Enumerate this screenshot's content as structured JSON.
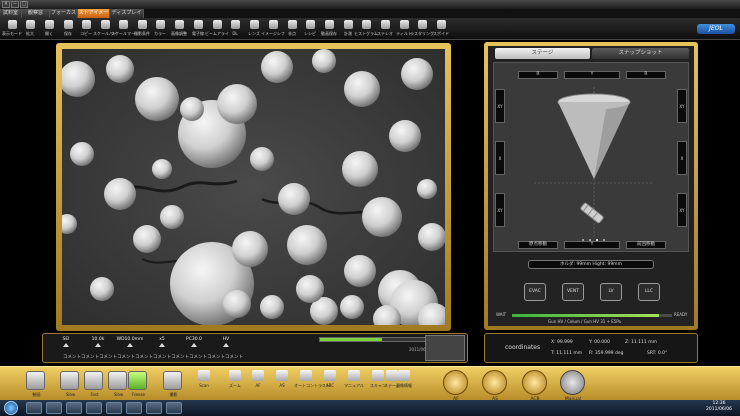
{
  "window": {
    "controls": [
      "×",
      "−",
      "□"
    ]
  },
  "mode_tabs": [
    {
      "label": "試料室"
    },
    {
      "label": "観察窓"
    },
    {
      "label": "フォーカス"
    },
    {
      "label": "ストアイメージ",
      "active": true
    },
    {
      "label": "ディスプレイ"
    }
  ],
  "toolbar": {
    "items": [
      {
        "label": "表示モード",
        "icon": "display-mode-icon"
      },
      {
        "label": "拡大",
        "icon": "zoom-icon"
      },
      {
        "label": "開く",
        "icon": "open-folder-icon"
      },
      {
        "label": "保存",
        "icon": "save-icon"
      },
      {
        "label": "コピー",
        "icon": "copy-icon"
      },
      {
        "label": "スケールバー",
        "icon": "scale-bar-icon"
      },
      {
        "label": "スケールマーク",
        "icon": "scale-mark-icon"
      },
      {
        "label": "撮影条件",
        "icon": "conditions-icon"
      },
      {
        "label": "カラー",
        "icon": "color-icon"
      },
      {
        "label": "画像調整",
        "icon": "image-adjust-icon"
      },
      {
        "label": "電子線",
        "icon": "beam-icon"
      },
      {
        "label": "ビームアライメント",
        "icon": "beam-align-icon"
      },
      {
        "label": "DL",
        "icon": "dl-icon"
      },
      {
        "label": "レンズ",
        "icon": "lens-icon"
      },
      {
        "label": "イメージシフト",
        "icon": "image-shift-icon"
      },
      {
        "label": "非点",
        "icon": "stigma-icon"
      },
      {
        "label": "レシピ",
        "icon": "recipe-icon"
      },
      {
        "label": "動画保存",
        "icon": "movie-icon"
      },
      {
        "label": "計測",
        "icon": "measure-icon"
      },
      {
        "label": "ヒストグラム",
        "icon": "histogram-icon"
      },
      {
        "label": "ステレオ",
        "icon": "stereo-icon"
      },
      {
        "label": "ティルト",
        "icon": "tilt-icon"
      },
      {
        "label": "ラスタリング",
        "icon": "raster-icon"
      },
      {
        "label": "スポイド",
        "icon": "eyedropper-icon"
      }
    ],
    "brand": "JEOL"
  },
  "status_bar": {
    "labels": [
      {
        "name": "SEI"
      },
      {
        "name": "10.0k"
      },
      {
        "name": "WD10.0mm"
      },
      {
        "name": "x5"
      },
      {
        "name": "PC30.0"
      },
      {
        "name": "HV"
      }
    ],
    "progress": 0.45,
    "comment": "コメントコメントコメントコメントコメントコメントコメントコメントコメントコメント",
    "date": "2011/06/06"
  },
  "right_panel": {
    "tabs": [
      "ステージ",
      "スナップショット"
    ],
    "top_buttons": [
      "R",
      "Y",
      "R"
    ],
    "side_buttons": [
      "XY",
      "XY",
      "X",
      "X",
      "XY",
      "XY"
    ],
    "bottom_buttons": [
      "原点移動",
      "Y",
      "前回移動"
    ],
    "holder_text": "ホルダ:  99mm    Hight: 99mm",
    "vac_buttons": [
      "EVAC",
      "VENT",
      "LV",
      "LLC"
    ],
    "vac_wait": "WAIT",
    "vac_ready": "READY",
    "vac_level": 0.92,
    "gun_hv": "Gun HV / Colum / Gun HV 31 + E5Pa"
  },
  "coordinates": {
    "label": "coordinates",
    "x": "X: 99.999",
    "y": "Y: 00.000",
    "z": "Z: 11.111 mm",
    "t": "T: 11.111 mm",
    "r": "R: 359.999 deg",
    "srt": "SRT: 0.0°"
  },
  "bottom_tools": [
    {
      "label": "動画"
    },
    {
      "label": "Slow"
    },
    {
      "label": "Fast"
    },
    {
      "label": "Slow"
    },
    {
      "label": "Freeze",
      "active": true
    },
    {
      "label": "撮影"
    }
  ],
  "bottom_tools2": [
    {
      "label": "Scan"
    },
    {
      "label": "ズーム"
    },
    {
      "label": "AF"
    },
    {
      "label": "AS"
    },
    {
      "label": "オートコントラスト"
    },
    {
      "label": "ABC"
    },
    {
      "label": "マニュアル"
    },
    {
      "label": "スキャン"
    },
    {
      "label": "ステージ"
    },
    {
      "label": "画像情報"
    }
  ],
  "round_buttons": [
    {
      "label": "AF"
    },
    {
      "label": "AS"
    },
    {
      "label": "ACB"
    },
    {
      "label": "Manual"
    }
  ],
  "taskbar": {
    "time": "12:36",
    "date": "2011/06/06"
  },
  "colors": {
    "gold": "#d8b040",
    "accent_tab": "#e08020",
    "progress_green": "#7cd43c"
  }
}
